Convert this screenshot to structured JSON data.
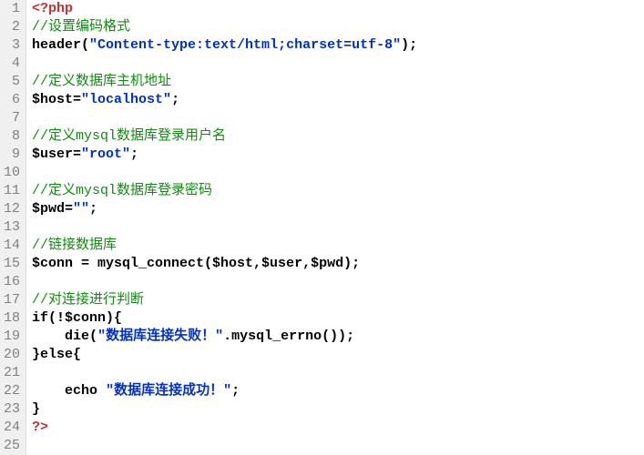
{
  "editor": {
    "lines": [
      {
        "n": 1,
        "tokens": [
          {
            "cls": "t-php",
            "text": "<?php"
          }
        ]
      },
      {
        "n": 2,
        "tokens": [
          {
            "cls": "t-comment",
            "text": "//设置编码格式"
          }
        ]
      },
      {
        "n": 3,
        "tokens": [
          {
            "cls": "t-default",
            "text": "header("
          },
          {
            "cls": "t-string",
            "text": "\"Content-type:text/html;charset=utf-8\""
          },
          {
            "cls": "t-default",
            "text": ");"
          }
        ]
      },
      {
        "n": 4,
        "tokens": []
      },
      {
        "n": 5,
        "tokens": [
          {
            "cls": "t-comment",
            "text": "//定义数据库主机地址"
          }
        ]
      },
      {
        "n": 6,
        "tokens": [
          {
            "cls": "t-default",
            "text": "$host="
          },
          {
            "cls": "t-string",
            "text": "\"localhost\""
          },
          {
            "cls": "t-default",
            "text": ";"
          }
        ]
      },
      {
        "n": 7,
        "tokens": []
      },
      {
        "n": 8,
        "tokens": [
          {
            "cls": "t-comment",
            "text": "//定义mysql数据库登录用户名"
          }
        ]
      },
      {
        "n": 9,
        "tokens": [
          {
            "cls": "t-default",
            "text": "$user="
          },
          {
            "cls": "t-string",
            "text": "\"root\""
          },
          {
            "cls": "t-default",
            "text": ";"
          }
        ]
      },
      {
        "n": 10,
        "tokens": []
      },
      {
        "n": 11,
        "tokens": [
          {
            "cls": "t-comment",
            "text": "//定义mysql数据库登录密码"
          }
        ]
      },
      {
        "n": 12,
        "tokens": [
          {
            "cls": "t-default",
            "text": "$pwd="
          },
          {
            "cls": "t-string",
            "text": "\"\""
          },
          {
            "cls": "t-default",
            "text": ";"
          }
        ]
      },
      {
        "n": 13,
        "tokens": []
      },
      {
        "n": 14,
        "tokens": [
          {
            "cls": "t-comment",
            "text": "//链接数据库"
          }
        ]
      },
      {
        "n": 15,
        "tokens": [
          {
            "cls": "t-default",
            "text": "$conn = mysql_connect($host,$user,$pwd);"
          }
        ]
      },
      {
        "n": 16,
        "tokens": []
      },
      {
        "n": 17,
        "tokens": [
          {
            "cls": "t-comment",
            "text": "//对连接进行判断"
          }
        ]
      },
      {
        "n": 18,
        "tokens": [
          {
            "cls": "t-keyword",
            "text": "if"
          },
          {
            "cls": "t-default",
            "text": "(!$conn){"
          }
        ]
      },
      {
        "n": 19,
        "tokens": [
          {
            "cls": "t-default",
            "text": "    "
          },
          {
            "cls": "t-keyword",
            "text": "die"
          },
          {
            "cls": "t-default",
            "text": "("
          },
          {
            "cls": "t-string",
            "text": "\"数据库连接失败！\""
          },
          {
            "cls": "t-default",
            "text": ".mysql_errno());"
          }
        ]
      },
      {
        "n": 20,
        "tokens": [
          {
            "cls": "t-default",
            "text": "}"
          },
          {
            "cls": "t-keyword",
            "text": "else"
          },
          {
            "cls": "t-default",
            "text": "{"
          }
        ]
      },
      {
        "n": 21,
        "tokens": []
      },
      {
        "n": 22,
        "tokens": [
          {
            "cls": "t-default",
            "text": "    "
          },
          {
            "cls": "t-keyword",
            "text": "echo"
          },
          {
            "cls": "t-default",
            "text": " "
          },
          {
            "cls": "t-string",
            "text": "\"数据库连接成功！\""
          },
          {
            "cls": "t-default",
            "text": ";"
          }
        ]
      },
      {
        "n": 23,
        "tokens": [
          {
            "cls": "t-default",
            "text": "}"
          }
        ]
      },
      {
        "n": 24,
        "tokens": [
          {
            "cls": "t-php",
            "text": "?>"
          }
        ]
      },
      {
        "n": 25,
        "tokens": []
      }
    ]
  }
}
